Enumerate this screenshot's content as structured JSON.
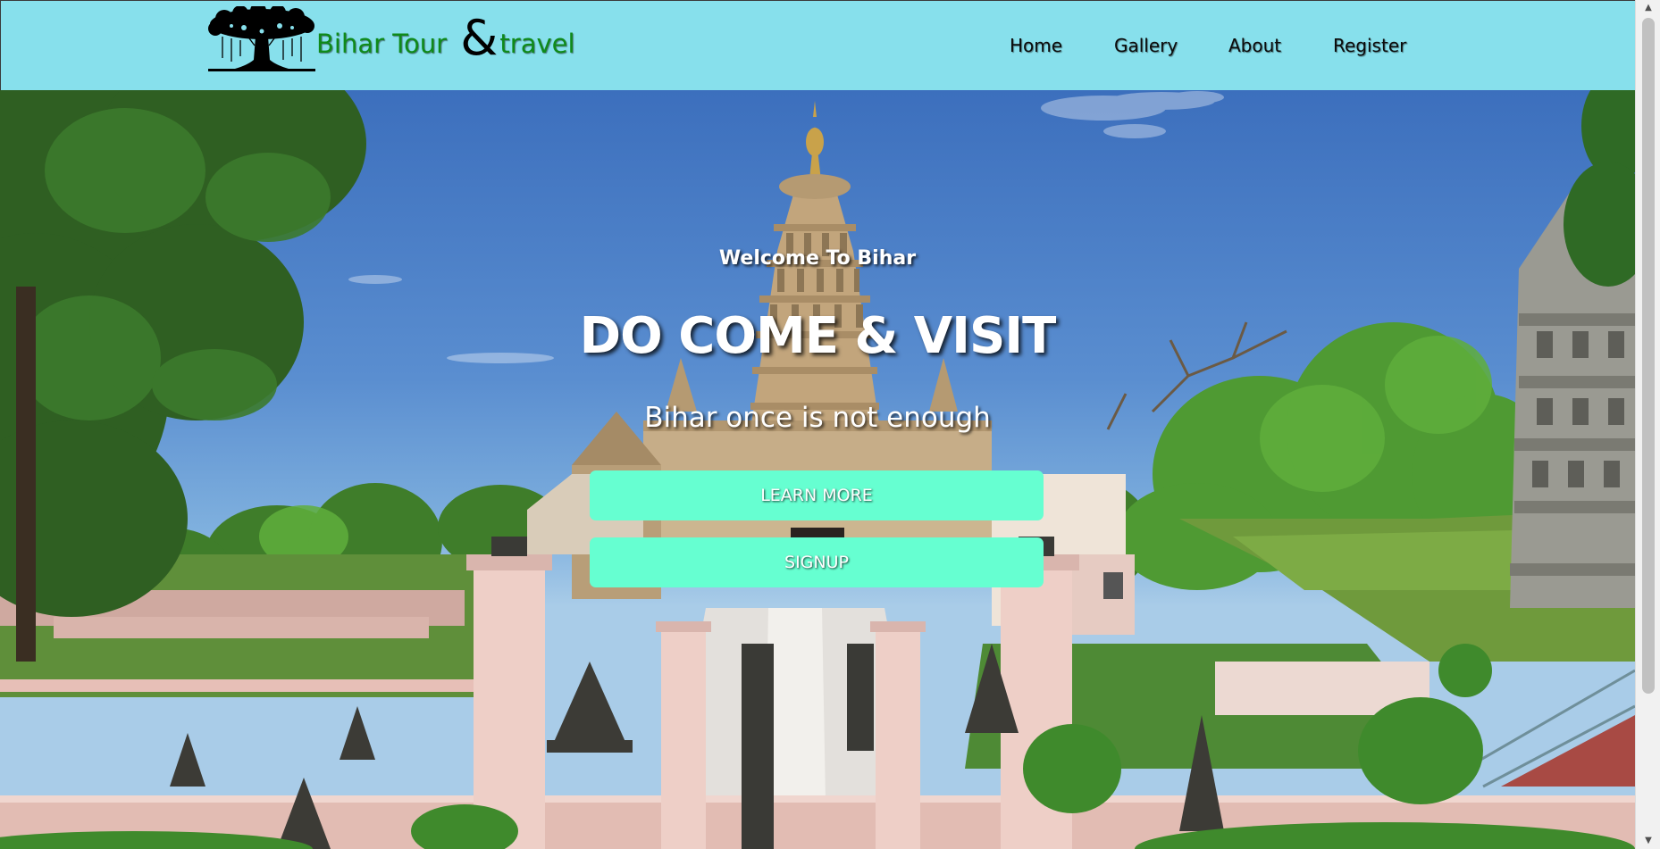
{
  "brand": {
    "name_part1": "Bihar Tour ",
    "ampersand": "&",
    "name_part2": "travel",
    "logo_icon": "banyan-tree-icon"
  },
  "nav": {
    "items": [
      {
        "label": "Home"
      },
      {
        "label": "Gallery"
      },
      {
        "label": "About"
      },
      {
        "label": "Register"
      }
    ]
  },
  "hero": {
    "welcome": "Welcome To Bihar",
    "headline": "DO COME & VISIT",
    "tagline": "Bihar once is not enough",
    "buttons": {
      "learn_more": "LEARN MORE",
      "signup": "SIGNUP"
    },
    "background_image": "mahabodhi-temple-photo"
  },
  "scrollbar": {
    "up_icon": "scroll-up-arrow-icon",
    "down_icon": "scroll-down-arrow-icon"
  },
  "colors": {
    "header_bg": "#87e0ec",
    "brand_green": "#0f8a1a",
    "button_bg": "#66ffd1",
    "text_on_hero": "#ffffff"
  }
}
